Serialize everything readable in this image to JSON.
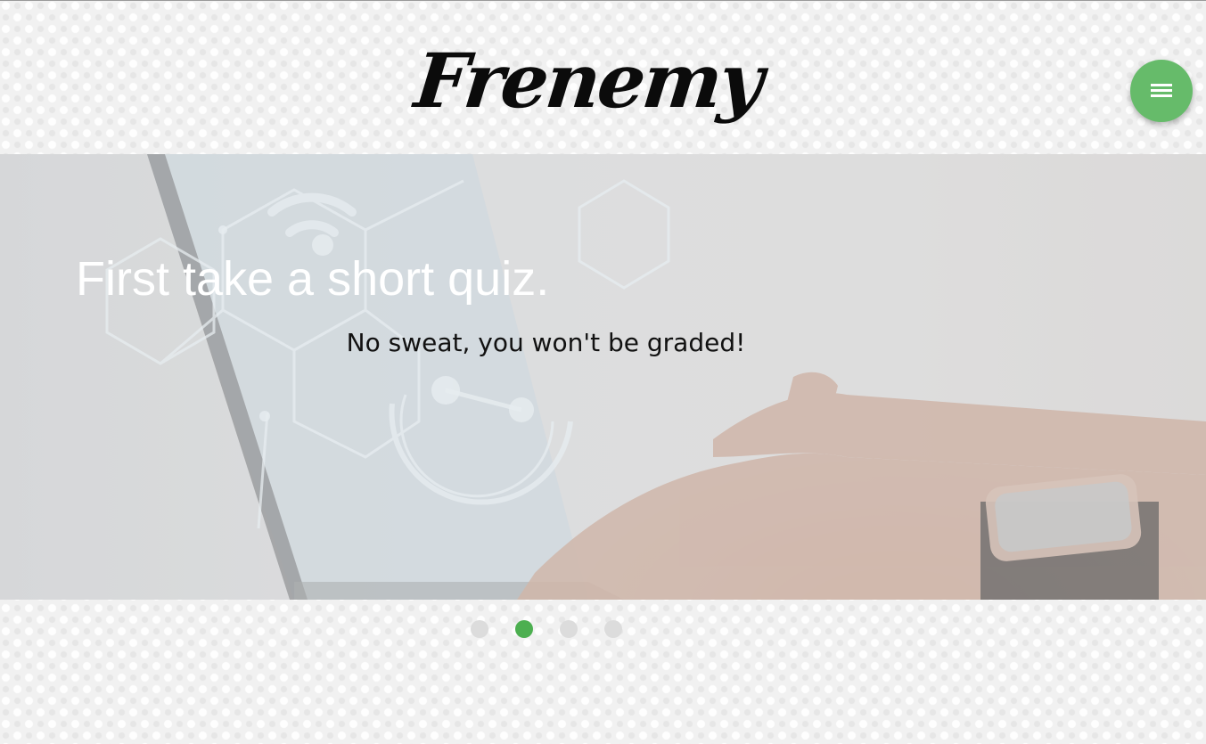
{
  "header": {
    "logo_text": "Frenemy",
    "menu_icon": "hamburger-menu-icon"
  },
  "slider": {
    "title": "First take a short quiz.",
    "subtitle": "No sweat, you won't be graded!",
    "slide_count": 4,
    "active_slide_index": 1
  },
  "colors": {
    "accent": "#4caf50",
    "fab": "#66bb6a",
    "dot_inactive": "#dcdcdc",
    "background": "#f1f1f1"
  }
}
